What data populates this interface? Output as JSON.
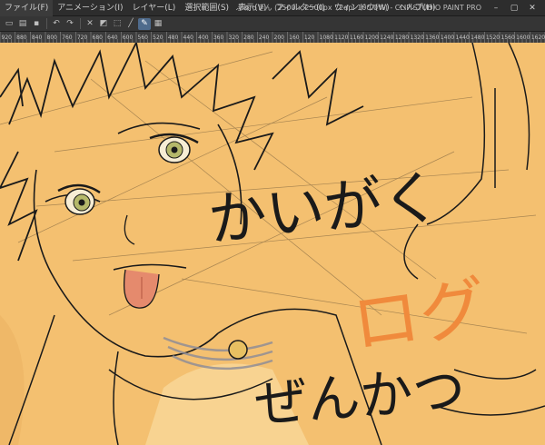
{
  "menu": {
    "items": [
      {
        "label": "ファイル(F)"
      },
      {
        "label": "アニメーション(I)"
      },
      {
        "label": "レイヤー(L)"
      },
      {
        "label": "選択範囲(S)"
      },
      {
        "label": "表示(V)"
      },
      {
        "label": "フィルター(I)"
      },
      {
        "label": "ウィンドウ(W)"
      },
      {
        "label": "ヘルプ(H)"
      }
    ],
    "window_title": "ふぁっきん (2500 x 2500px 72dpi 100.0%) - CLIP STUDIO PAINT PRO"
  },
  "toolbar": {
    "buttons": [
      {
        "icon": "new-file-icon",
        "glyph": "▭"
      },
      {
        "icon": "open-icon",
        "glyph": "▤"
      },
      {
        "icon": "save-icon",
        "glyph": "▪"
      },
      {
        "icon": "undo-icon",
        "glyph": "↶"
      },
      {
        "icon": "redo-icon",
        "glyph": "↷"
      },
      {
        "icon": "clear-icon",
        "glyph": "✕"
      },
      {
        "icon": "fill-icon",
        "glyph": "◩"
      },
      {
        "icon": "transform-icon",
        "glyph": "⬚"
      },
      {
        "icon": "pen-icon",
        "glyph": "╱"
      },
      {
        "icon": "brush-icon",
        "glyph": "✎"
      },
      {
        "icon": "grid-icon",
        "glyph": "▦"
      }
    ],
    "active_index": 9
  },
  "ruler": {
    "labels": [
      "920",
      "880",
      "840",
      "800",
      "760",
      "720",
      "680",
      "640",
      "600",
      "560",
      "520",
      "480",
      "440",
      "400",
      "360",
      "320",
      "280",
      "240",
      "200",
      "160",
      "120",
      "1080",
      "1120",
      "1160",
      "1200",
      "1240",
      "1280",
      "1320",
      "1360",
      "1400",
      "1440",
      "1480",
      "1520",
      "1560",
      "1600",
      "1620"
    ]
  },
  "canvas": {
    "background_color": "#f4c070",
    "line_color": "#1a1a1a",
    "accent_color": "#f08a3c",
    "handwritten_black_1": "かいがく",
    "handwritten_orange": "ログ",
    "handwritten_black_2": "ぜんかつ"
  },
  "colors": {
    "menubar_bg": "#2d2d2d",
    "toolbar_bg": "#353535",
    "ruler_bg": "#3d3d3d",
    "active_tool": "#4f6b8c"
  }
}
